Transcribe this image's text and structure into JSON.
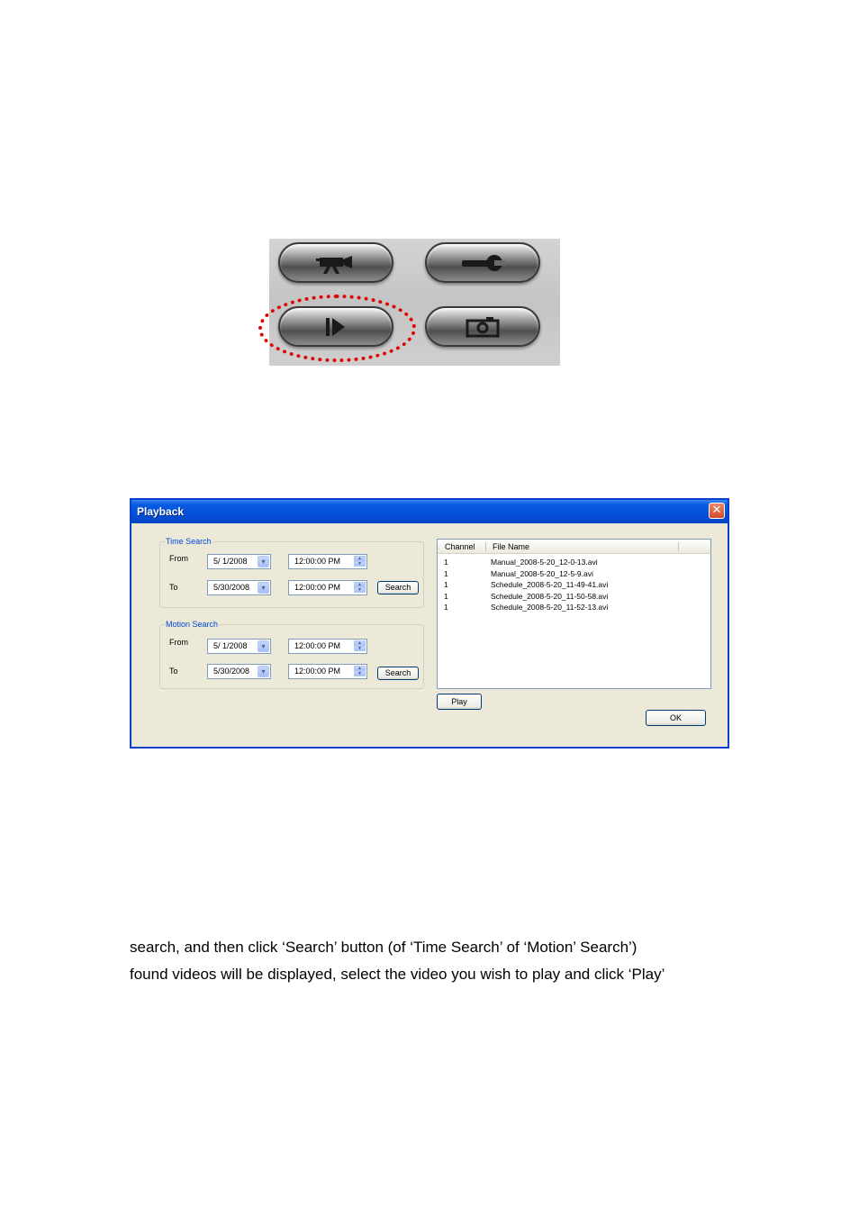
{
  "toolbar_buttons": [
    {
      "icon": "video-camera-icon"
    },
    {
      "icon": "wrench-icon"
    },
    {
      "icon": "play-icon",
      "highlighted": true
    },
    {
      "icon": "snapshot-camera-icon"
    }
  ],
  "dialog": {
    "title": "Playback",
    "close_glyph": "✕",
    "time_search": {
      "label": "Time Search",
      "from_label": "From",
      "from_date": "5/  1/2008",
      "from_time": "12:00:00 PM",
      "to_label": "To",
      "to_date": "5/30/2008",
      "to_time": "12:00:00 PM",
      "search_label": "Search"
    },
    "motion_search": {
      "label": "Motion Search",
      "from_label": "From",
      "from_date": "5/  1/2008",
      "from_time": "12:00:00 PM",
      "to_label": "To",
      "to_date": "5/30/2008",
      "to_time": "12:00:00 PM",
      "search_label": "Search"
    },
    "list": {
      "columns": [
        "Channel",
        "File Name"
      ],
      "rows": [
        {
          "channel": "1",
          "file": "Manual_2008-5-20_12-0-13.avi"
        },
        {
          "channel": "1",
          "file": "Manual_2008-5-20_12-5-9.avi"
        },
        {
          "channel": "1",
          "file": "Schedule_2008-5-20_11-49-41.avi"
        },
        {
          "channel": "1",
          "file": "Schedule_2008-5-20_11-50-58.avi"
        },
        {
          "channel": "1",
          "file": "Schedule_2008-5-20_11-52-13.avi"
        }
      ]
    },
    "play_label": "Play",
    "ok_label": "OK"
  },
  "body_text": [
    "search, and then click ‘Search’ button (of ‘Time Search’ of ‘Motion’ Search’)",
    "found videos will be displayed, select the video you wish to play and click ‘Play’"
  ],
  "colors": {
    "highlight": "#e00000",
    "titlebar": "#0a5be0",
    "group_label": "#0046d5"
  }
}
